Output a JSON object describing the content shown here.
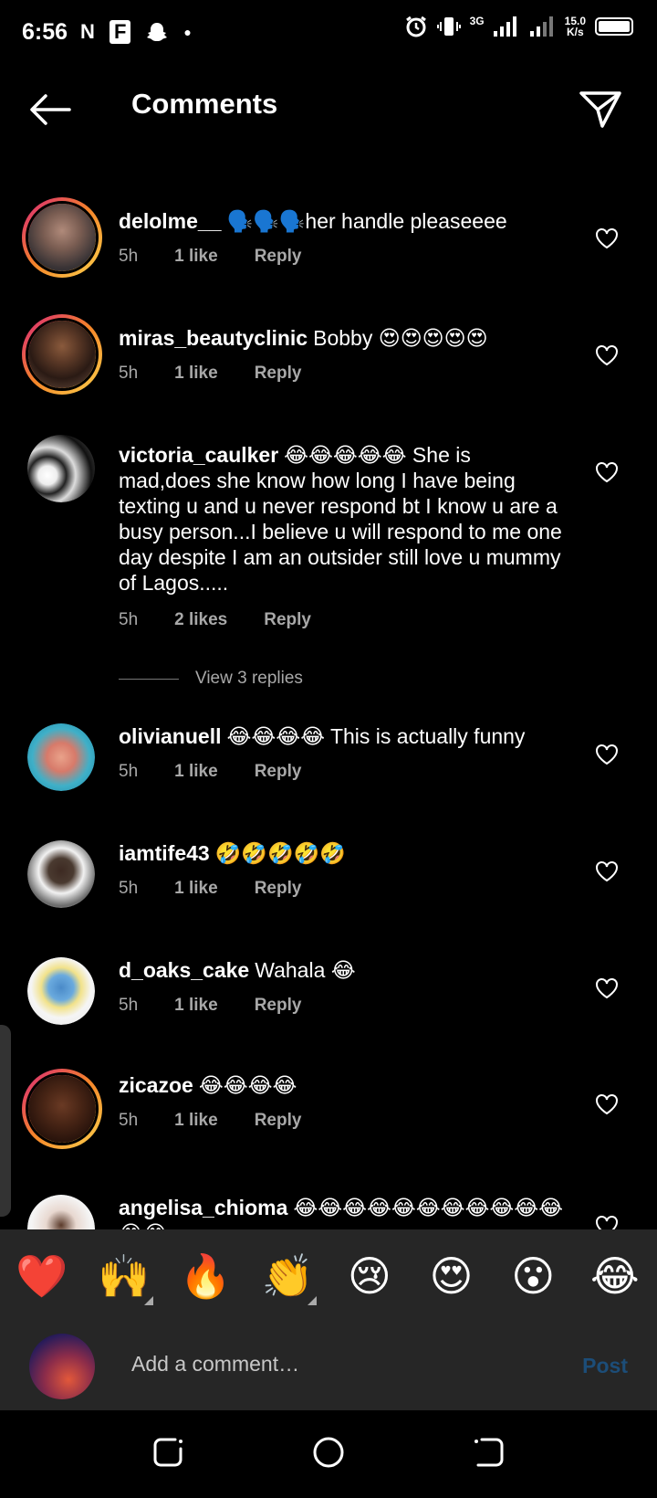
{
  "status_bar": {
    "time": "6:56",
    "app_icons": [
      "N",
      "F"
    ],
    "network": "3G",
    "speed_value": "15.0",
    "speed_unit": "K/s"
  },
  "header": {
    "title": "Comments"
  },
  "comments": [
    {
      "username": "delolme__",
      "text": "🗣️🗣️🗣️her handle pleaseeee",
      "time": "5h",
      "likes": "1 like",
      "reply": "Reply"
    },
    {
      "username": "miras_beautyclinic",
      "text": "Bobby 😍😍😍😍😍",
      "time": "5h",
      "likes": "1 like",
      "reply": "Reply"
    },
    {
      "username": "victoria_caulker",
      "text": "😂😂😂😂😂 She is mad,does she know how long I have being texting u and u never respond bt I know u are a busy person...I believe u will respond to me one day despite I am an outsider still love u mummy of Lagos.....",
      "time": "5h",
      "likes": "2 likes",
      "reply": "Reply"
    },
    {
      "username": "olivianuell",
      "text": "😂😂😂😂 This is actually funny",
      "time": "5h",
      "likes": "1 like",
      "reply": "Reply"
    },
    {
      "username": "iamtife43",
      "text": "🤣🤣🤣🤣🤣",
      "time": "5h",
      "likes": "1 like",
      "reply": "Reply"
    },
    {
      "username": "d_oaks_cake",
      "text": "Wahala 😂",
      "time": "5h",
      "likes": "1 like",
      "reply": "Reply"
    },
    {
      "username": "zicazoe",
      "text": "😂😂😂😂",
      "time": "5h",
      "likes": "1 like",
      "reply": "Reply"
    },
    {
      "username": "angelisa_chioma",
      "text": "😂😂😂😂😂😂😂😂😂😂😂😂😂",
      "time": "",
      "likes": "",
      "reply": ""
    }
  ],
  "view_replies": "View 3 replies",
  "reactions": [
    "❤️",
    "🙌",
    "🔥",
    "👏",
    "😢",
    "😍",
    "😮",
    "😂"
  ],
  "compose": {
    "placeholder": "Add a comment…",
    "post_label": "Post"
  }
}
